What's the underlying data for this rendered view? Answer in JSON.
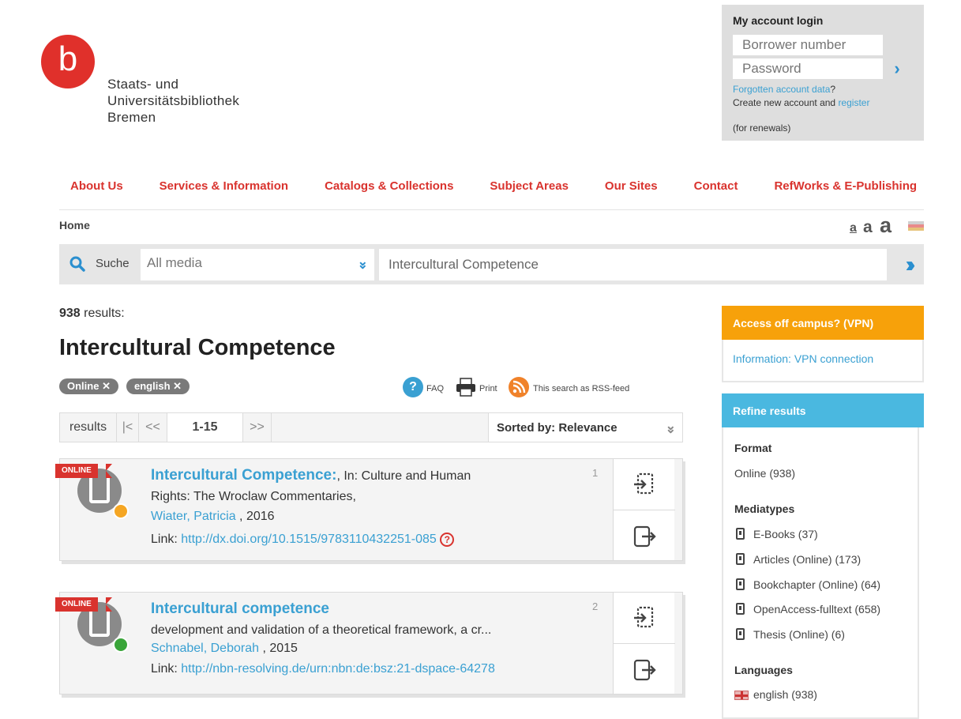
{
  "logo": {
    "letter": "b",
    "line1": "Staats- und",
    "line2": "Universitätsbibliothek",
    "line3": "Bremen"
  },
  "login": {
    "title": "My account login",
    "borrower_placeholder": "Borrower number",
    "password_placeholder": "Password",
    "forgot_link": "Forgotten account data",
    "forgot_suffix": "?",
    "create_text": "Create new account and",
    "register_link": "register",
    "renewals": "(for renewals)"
  },
  "nav": {
    "items": [
      "About Us",
      "Services & Information",
      "Catalogs & Collections",
      "Subject Areas",
      "Our Sites",
      "Contact",
      "RefWorks & E-Publishing"
    ]
  },
  "breadcrumb": {
    "home": "Home"
  },
  "fontsize": {
    "small": "a",
    "medium": "a",
    "large": "a"
  },
  "search": {
    "label": "Suche",
    "media": "All media",
    "query": "Intercultural Competence"
  },
  "results": {
    "count": "938",
    "count_label": "results:",
    "title": "Intercultural Competence",
    "filters": [
      {
        "label": "Online"
      },
      {
        "label": "english"
      }
    ],
    "tools": {
      "faq": "FAQ",
      "print": "Print",
      "rss": "This search as RSS-feed"
    }
  },
  "pager": {
    "label": "results",
    "first": "|<",
    "prev": "<<",
    "range": "1-15",
    "next": ">>",
    "sort": "Sorted by: Relevance"
  },
  "items": [
    {
      "num": "1",
      "badge": "ONLINE",
      "title": "Intercultural Competence:",
      "title_suffix": ", In: Culture and Human",
      "line2": "Rights: The Wroclaw Commentaries,",
      "author": "Wiater, Patricia",
      "year": ", 2016",
      "link_label": "Link:",
      "link": "http://dx.doi.org/10.1515/9783110432251-085",
      "dot_color": "#f5a623"
    },
    {
      "num": "2",
      "badge": "ONLINE",
      "title": "Intercultural competence",
      "title_suffix": "",
      "line2": "development and validation of a theoretical framework, a cr...",
      "author": "Schnabel, Deborah",
      "year": ", 2015",
      "link_label": "Link:",
      "link": "http://nbn-resolving.de/urn:nbn:de:bsz:21-dspace-64278",
      "dot_color": "#3aa53a"
    }
  ],
  "vpn": {
    "title": "Access off campus? (VPN)",
    "link": "Information: VPN connection"
  },
  "refine": {
    "title": "Refine results",
    "format_heading": "Format",
    "format_items": [
      "Online (938)"
    ],
    "mediatypes_heading": "Mediatypes",
    "mediatypes": [
      "E-Books (37)",
      "Articles (Online) (173)",
      "Bookchapter (Online) (64)",
      "OpenAccess-fulltext (658)",
      "Thesis (Online) (6)"
    ],
    "languages_heading": "Languages",
    "languages": [
      "english (938)"
    ]
  },
  "colors": {
    "brand_red": "#e0302b",
    "link_blue": "#3aa0d2",
    "vpn_orange": "#f7a10a",
    "refine_blue": "#4ab8e0"
  }
}
